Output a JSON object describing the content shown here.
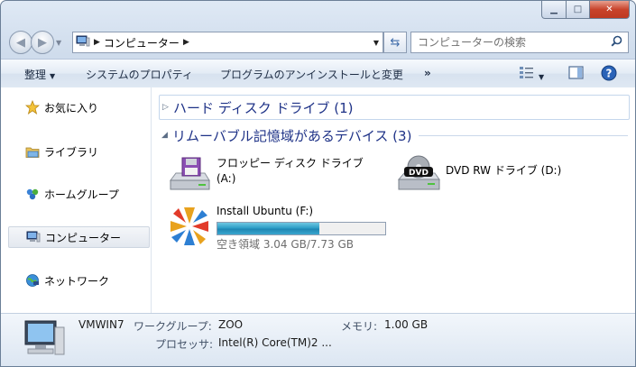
{
  "window": {
    "caption_buttons": [
      {
        "name": "minimize",
        "glyph": "▁"
      },
      {
        "name": "maximize",
        "glyph": "□"
      },
      {
        "name": "close",
        "glyph": "✕"
      }
    ]
  },
  "address_bar": {
    "location": "コンピューター",
    "search_placeholder": "コンピューターの検索"
  },
  "toolbar": {
    "organize": "整理",
    "system_properties": "システムのプロパティ",
    "uninstall": "プログラムのアンインストールと変更",
    "more": "»"
  },
  "sidebar": {
    "items": [
      {
        "label": "お気に入り",
        "icon": "star-icon"
      },
      {
        "label": "ライブラリ",
        "icon": "library-icon"
      },
      {
        "label": "ホームグループ",
        "icon": "homegroup-icon"
      },
      {
        "label": "コンピューター",
        "icon": "computer-icon",
        "selected": true
      },
      {
        "label": "ネットワーク",
        "icon": "network-icon"
      }
    ]
  },
  "groups": [
    {
      "label": "ハード ディスク ドライブ (1)",
      "collapsed": true
    },
    {
      "label": "リムーバブル記憶域があるデバイス (3)",
      "collapsed": false
    }
  ],
  "devices": [
    {
      "name": "フロッピー ディスク ドライブ",
      "sub": "(A:)",
      "icon": "floppy-drive-icon"
    },
    {
      "name": "DVD RW ドライブ (D:)",
      "icon": "dvd-drive-icon",
      "badge": "DVD"
    },
    {
      "name": "Install Ubuntu (F:)",
      "icon": "ubuntu-icon",
      "free_text": "空き領域 3.04 GB/7.73 GB",
      "used_fraction": 0.607
    }
  ],
  "details": {
    "computer_name": "VMWIN7",
    "workgroup_label": "ワークグループ:",
    "workgroup_value": "ZOO",
    "memory_label": "メモリ:",
    "memory_value": "1.00 GB",
    "processor_label": "プロセッサ:",
    "processor_value": "Intel(R) Core(TM)2 ..."
  },
  "colors": {
    "accent": "#1e3287",
    "progress": "#2e9ec7"
  }
}
